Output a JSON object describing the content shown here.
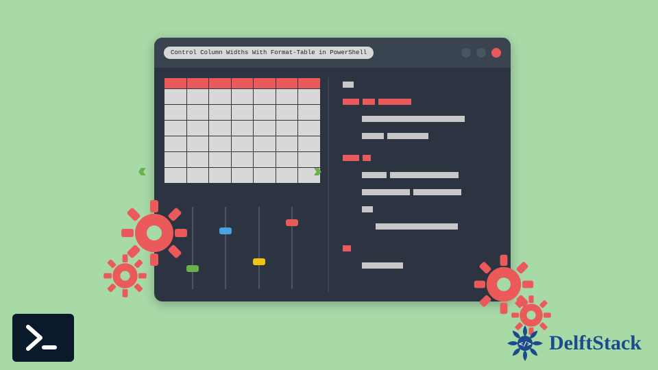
{
  "window": {
    "title": "Control Column Widths With Format-Table in PowerShell",
    "traffic_colors": [
      "#4a5562",
      "#4a5562",
      "#ea5a5a"
    ]
  },
  "grid": {
    "rows": 7,
    "cols": 7
  },
  "sliders": [
    {
      "color": "#6ab04c",
      "position": 0.72
    },
    {
      "color": "#4aa3df",
      "position": 0.26
    },
    {
      "color": "#f1c40f",
      "position": 0.63
    },
    {
      "color": "#ea5a5a",
      "position": 0.16
    }
  ],
  "arrows": {
    "left": "‹‹",
    "right": "››"
  },
  "brand": {
    "name": "DelftStack",
    "ps_glyph": ">_"
  },
  "accent_colors": {
    "red": "#ea5a5a",
    "green": "#6ab04c",
    "blue": "#4aa3df",
    "yellow": "#f1c40f",
    "bg": "#a8daa8",
    "panel": "#2b3440"
  }
}
